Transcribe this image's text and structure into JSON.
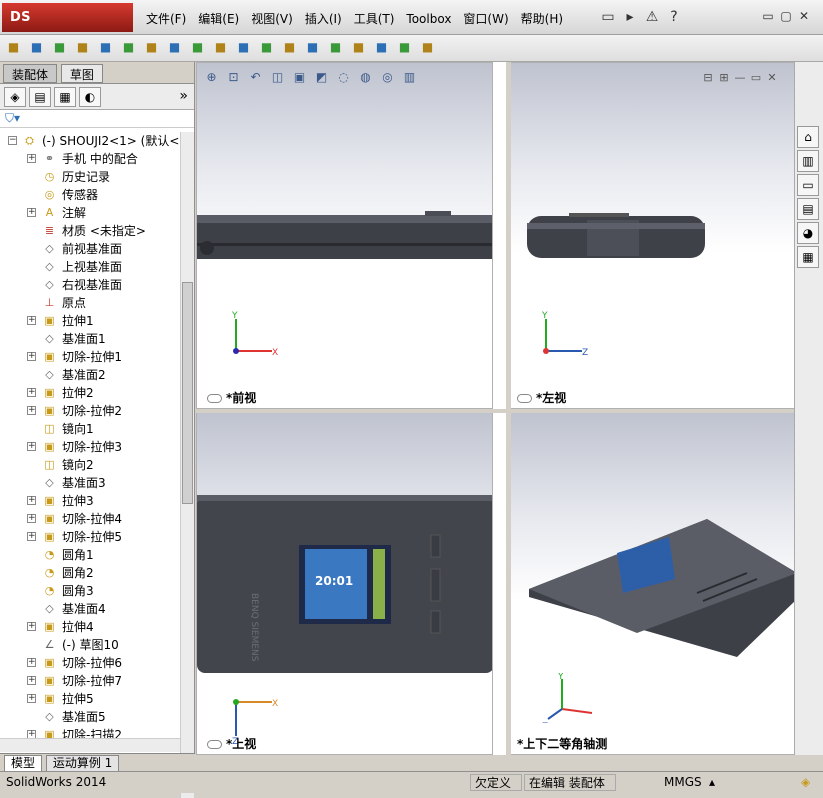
{
  "app": {
    "logo_text": "DS SOLIDWORKS",
    "status_version": "SolidWorks 2014"
  },
  "menu": [
    "文件(F)",
    "编辑(E)",
    "视图(V)",
    "插入(I)",
    "工具(T)",
    "Toolbox",
    "窗口(W)",
    "帮助(H)"
  ],
  "quick_access": [
    {
      "name": "new-icon",
      "glyph": "▭"
    },
    {
      "name": "open-icon",
      "glyph": "▸"
    },
    {
      "name": "rebuild-warning-icon",
      "glyph": "⚠"
    },
    {
      "name": "help-icon",
      "glyph": "?"
    }
  ],
  "window_controls": [
    "▭",
    "▢",
    "✕"
  ],
  "toolbar_icons": [
    "insert-component-icon",
    "mate-icon",
    "linear-pattern-icon",
    "smart-fasteners-icon",
    "move-component-icon",
    "show-hidden-icon",
    "assembly-features-icon",
    "reference-geometry-icon",
    "new-motion-study-icon",
    "bill-of-materials-icon",
    "exploded-view-icon",
    "explode-line-sketch-icon",
    "interference-detection-icon",
    "clearance-verification-icon",
    "hole-alignment-icon",
    "measure-icon",
    "assembly-visualization-icon",
    "instant3d-icon",
    "snapshot-icon"
  ],
  "left_tabs": {
    "assembly": "装配体",
    "sketch": "草图"
  },
  "panel_manager_icons": [
    "featuremanager-icon",
    "propertymanager-icon",
    "configurationmanager-icon",
    "displaymanager-icon"
  ],
  "tree": {
    "root": "(-) SHOUJI2<1> (默认<<默认",
    "items": [
      {
        "label": "手机 中的配合",
        "icon": "mates-icon",
        "glyph": "⚭",
        "exp": true,
        "color": "c-gr"
      },
      {
        "label": "历史记录",
        "icon": "history-icon",
        "glyph": "◷",
        "exp": false,
        "color": "c-y"
      },
      {
        "label": "传感器",
        "icon": "sensors-icon",
        "glyph": "◎",
        "exp": false,
        "color": "c-y"
      },
      {
        "label": "注解",
        "icon": "annotations-icon",
        "glyph": "A",
        "exp": true,
        "color": "c-y"
      },
      {
        "label": "材质 <未指定>",
        "icon": "material-icon",
        "glyph": "≣",
        "exp": false,
        "color": "c-r"
      },
      {
        "label": "前视基准面",
        "icon": "plane-icon",
        "glyph": "◇",
        "exp": false,
        "color": "c-gr"
      },
      {
        "label": "上视基准面",
        "icon": "plane-icon",
        "glyph": "◇",
        "exp": false,
        "color": "c-gr"
      },
      {
        "label": "右视基准面",
        "icon": "plane-icon",
        "glyph": "◇",
        "exp": false,
        "color": "c-gr"
      },
      {
        "label": "原点",
        "icon": "origin-icon",
        "glyph": "⊥",
        "exp": false,
        "color": "c-r"
      },
      {
        "label": "拉伸1",
        "icon": "extrude-icon",
        "glyph": "▣",
        "exp": true,
        "color": "c-y"
      },
      {
        "label": "基准面1",
        "icon": "plane-icon",
        "glyph": "◇",
        "exp": false,
        "color": "c-gr"
      },
      {
        "label": "切除-拉伸1",
        "icon": "cut-extrude-icon",
        "glyph": "▣",
        "exp": true,
        "color": "c-y"
      },
      {
        "label": "基准面2",
        "icon": "plane-icon",
        "glyph": "◇",
        "exp": false,
        "color": "c-gr"
      },
      {
        "label": "拉伸2",
        "icon": "extrude-icon",
        "glyph": "▣",
        "exp": true,
        "color": "c-y"
      },
      {
        "label": "切除-拉伸2",
        "icon": "cut-extrude-icon",
        "glyph": "▣",
        "exp": true,
        "color": "c-y"
      },
      {
        "label": "镜向1",
        "icon": "mirror-icon",
        "glyph": "◫",
        "exp": false,
        "color": "c-y"
      },
      {
        "label": "切除-拉伸3",
        "icon": "cut-extrude-icon",
        "glyph": "▣",
        "exp": true,
        "color": "c-y"
      },
      {
        "label": "镜向2",
        "icon": "mirror-icon",
        "glyph": "◫",
        "exp": false,
        "color": "c-y"
      },
      {
        "label": "基准面3",
        "icon": "plane-icon",
        "glyph": "◇",
        "exp": false,
        "color": "c-gr"
      },
      {
        "label": "拉伸3",
        "icon": "extrude-icon",
        "glyph": "▣",
        "exp": true,
        "color": "c-y"
      },
      {
        "label": "切除-拉伸4",
        "icon": "cut-extrude-icon",
        "glyph": "▣",
        "exp": true,
        "color": "c-y"
      },
      {
        "label": "切除-拉伸5",
        "icon": "cut-extrude-icon",
        "glyph": "▣",
        "exp": true,
        "color": "c-y"
      },
      {
        "label": "圆角1",
        "icon": "fillet-icon",
        "glyph": "◔",
        "exp": false,
        "color": "c-y"
      },
      {
        "label": "圆角2",
        "icon": "fillet-icon",
        "glyph": "◔",
        "exp": false,
        "color": "c-y"
      },
      {
        "label": "圆角3",
        "icon": "fillet-icon",
        "glyph": "◔",
        "exp": false,
        "color": "c-y"
      },
      {
        "label": "基准面4",
        "icon": "plane-icon",
        "glyph": "◇",
        "exp": false,
        "color": "c-gr"
      },
      {
        "label": "拉伸4",
        "icon": "extrude-icon",
        "glyph": "▣",
        "exp": true,
        "color": "c-y"
      },
      {
        "label": "(-) 草图10",
        "icon": "sketch-icon",
        "glyph": "∠",
        "exp": false,
        "color": "c-gr"
      },
      {
        "label": "切除-拉伸6",
        "icon": "cut-extrude-icon",
        "glyph": "▣",
        "exp": true,
        "color": "c-y"
      },
      {
        "label": "切除-拉伸7",
        "icon": "cut-extrude-icon",
        "glyph": "▣",
        "exp": true,
        "color": "c-y"
      },
      {
        "label": "拉伸5",
        "icon": "extrude-icon",
        "glyph": "▣",
        "exp": true,
        "color": "c-y"
      },
      {
        "label": "基准面5",
        "icon": "plane-icon",
        "glyph": "◇",
        "exp": false,
        "color": "c-gr"
      },
      {
        "label": "切除-扫描2",
        "icon": "cut-sweep-icon",
        "glyph": "▣",
        "exp": true,
        "color": "c-y"
      }
    ]
  },
  "bottom_tabs": {
    "model": "模型",
    "motion": "运动算例 1"
  },
  "viewports": [
    {
      "id": "vp-front",
      "name": "*前视",
      "axes": [
        "Y",
        "X"
      ]
    },
    {
      "id": "vp-left",
      "name": "*左视",
      "axes": [
        "Y",
        "Z"
      ]
    },
    {
      "id": "vp-top",
      "name": "*上视",
      "axes": [
        "X",
        "Z"
      ]
    },
    {
      "id": "vp-iso",
      "name": "*上下二等角轴测",
      "axes": [
        "Y",
        "X",
        "Z"
      ]
    }
  ],
  "phone_screen": {
    "time": "20:01",
    "brand": "BENQ SIEMENS"
  },
  "view_toolbar_icons": [
    "zoom-to-fit-icon",
    "zoom-to-area-icon",
    "previous-view-icon",
    "section-view-icon",
    "view-orientation-icon",
    "display-style-icon",
    "hide-show-items-icon",
    "edit-appearance-icon",
    "apply-scene-icon",
    "view-settings-icon"
  ],
  "viewport_controls": [
    "⊟",
    "⊞",
    "—",
    "▭",
    "✕"
  ],
  "task_pane_icons": [
    "solidworks-resources-icon",
    "design-library-icon",
    "file-explorer-icon",
    "view-palette-icon",
    "appearances-icon",
    "custom-properties-icon"
  ],
  "status": {
    "under_defined": "欠定义",
    "editing": "在编辑 装配体",
    "units": "MMGS",
    "units_arrow": "▴"
  }
}
